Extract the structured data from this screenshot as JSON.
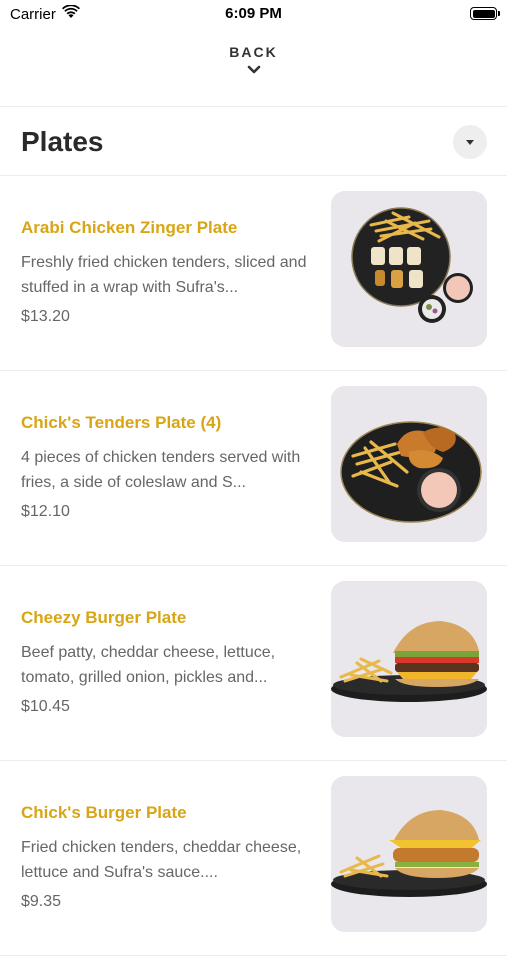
{
  "status_bar": {
    "carrier": "Carrier",
    "time": "6:09 PM"
  },
  "nav": {
    "back_label": "BACK"
  },
  "section": {
    "title": "Plates"
  },
  "colors": {
    "accent": "#d9a514",
    "text": "#666666",
    "divider": "#ececec"
  },
  "items": [
    {
      "name": "Arabi Chicken Zinger Plate",
      "description": "Freshly fried chicken tenders, sliced and stuffed in a wrap with Sufra's...",
      "price": "$13.20"
    },
    {
      "name": "Chick's Tenders Plate (4)",
      "description": "4 pieces of chicken tenders served with fries, a side of coleslaw and S...",
      "price": "$12.10"
    },
    {
      "name": "Cheezy Burger Plate",
      "description": "Beef patty, cheddar cheese, lettuce, tomato, grilled onion, pickles and...",
      "price": "$10.45"
    },
    {
      "name": "Chick's Burger Plate",
      "description": "Fried chicken tenders, cheddar cheese, lettuce and Sufra's sauce....",
      "price": "$9.35"
    }
  ]
}
